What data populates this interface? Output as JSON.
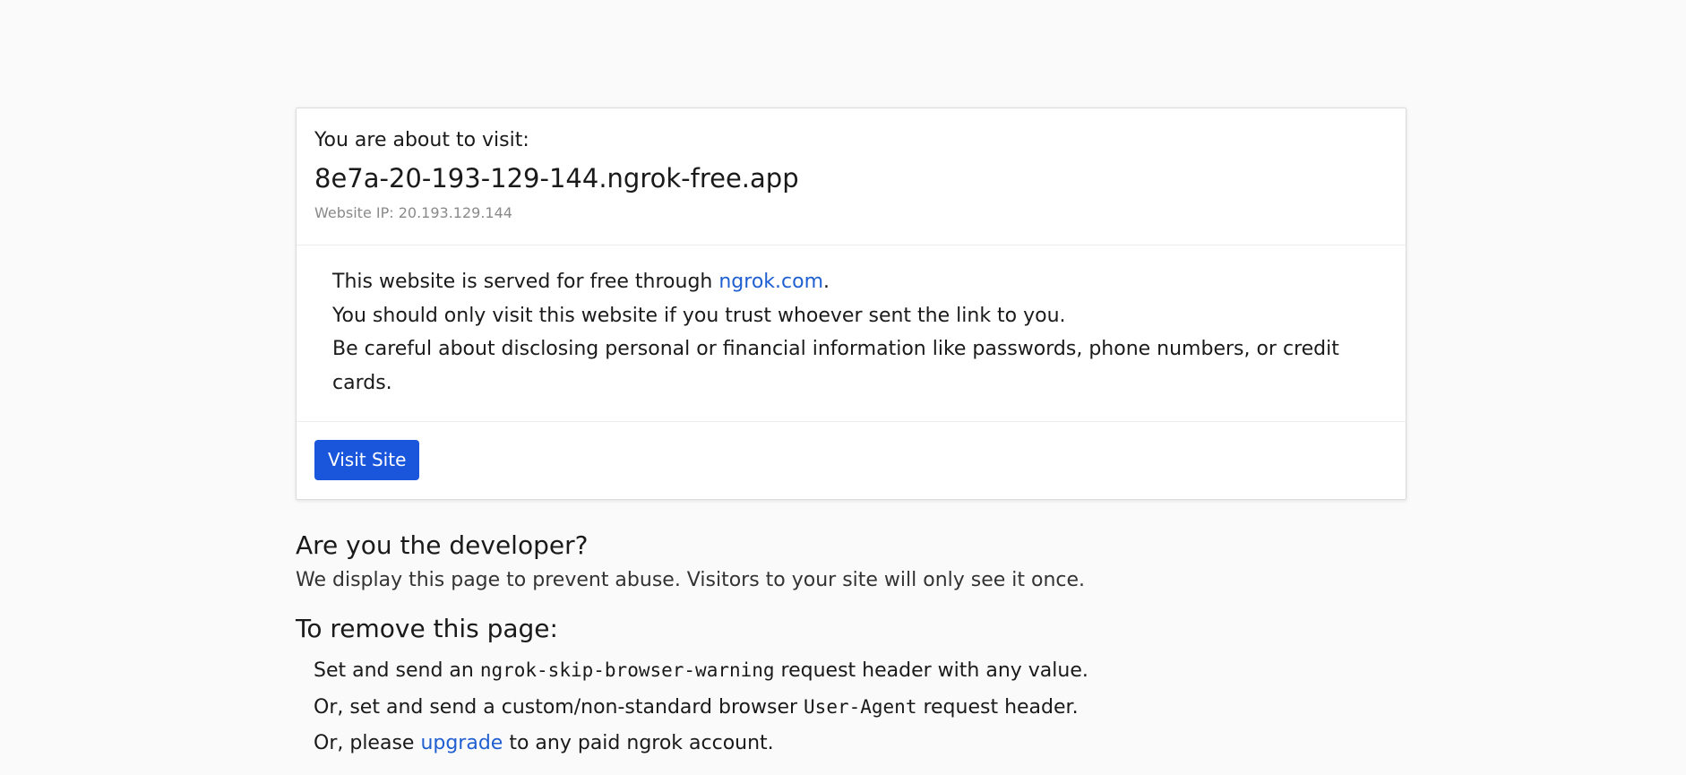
{
  "card": {
    "about_label": "You are about to visit:",
    "hostname": "8e7a-20-193-129-144.ngrok-free.app",
    "ip_text": "Website IP: 20.193.129.144",
    "body": {
      "line1_prefix": "This website is served for free through ",
      "line1_link": "ngrok.com",
      "line1_suffix": ".",
      "line2": "You should only visit this website if you trust whoever sent the link to you.",
      "line3": "Be careful about disclosing personal or financial information like passwords, phone numbers, or credit cards."
    },
    "visit_button": "Visit Site"
  },
  "developer": {
    "heading": "Are you the developer?",
    "description": "We display this page to prevent abuse. Visitors to your site will only see it once.",
    "remove_heading": "To remove this page:",
    "steps": {
      "s1_prefix": "Set and send an ",
      "s1_code": "ngrok-skip-browser-warning",
      "s1_suffix": " request header with any value.",
      "s2_prefix": "Or, set and send a custom/non-standard browser ",
      "s2_code": "User-Agent",
      "s2_suffix": " request header.",
      "s3_prefix": "Or, please ",
      "s3_link": "upgrade",
      "s3_suffix": " to any paid ngrok account."
    }
  },
  "colors": {
    "background": "#fafafa",
    "button": "#1a56db",
    "link": "#1f5fd1",
    "muted": "#8a8a8a"
  }
}
